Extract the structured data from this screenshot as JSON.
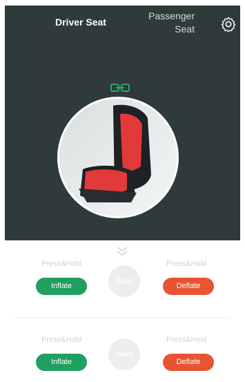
{
  "tabs": {
    "driver": "Driver Seat",
    "passenger_line1": "Passenger",
    "passenger_line2": "Seat"
  },
  "icons": {
    "settings": "gear-icon",
    "link": "link-icon",
    "expand": "double-chevron-down-icon"
  },
  "zones": [
    {
      "name": "Back",
      "left_label": "Press&Hold",
      "right_label": "Press&Hold",
      "inflate": "Inflate",
      "deflate": "Deflate"
    },
    {
      "name": "Waist",
      "left_label": "Press&Hold",
      "right_label": "Press&Hold",
      "inflate": "Inflate",
      "deflate": "Deflate"
    }
  ],
  "colors": {
    "panel": "#2e3b3a",
    "inflate": "#1fa05f",
    "deflate": "#e85433",
    "accent": "#2bb673",
    "seat_red": "#e23a3a"
  }
}
